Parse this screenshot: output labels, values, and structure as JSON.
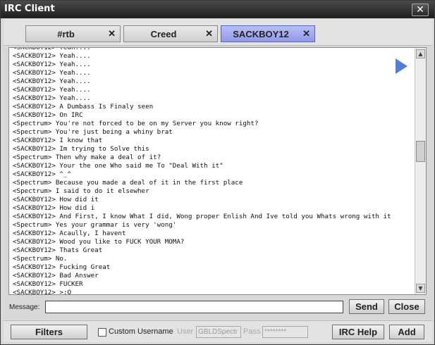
{
  "window": {
    "title": "IRC Client",
    "close_glyph": "✕"
  },
  "tabs": [
    {
      "label": "#rtb",
      "close": "✕",
      "active": false
    },
    {
      "label": "Creed",
      "close": "✕",
      "active": false
    },
    {
      "label": "SACKBOY12",
      "close": "✕",
      "active": true
    }
  ],
  "chat": {
    "lines": [
      "<SACKBOY12> Yeah....",
      "<SACKBOY12> Yeah....",
      "<SACKBOY12> Yeah....",
      "<SACKBOY12> Yeah....",
      "<SACKBOY12> Yeah....",
      "<SACKBOY12> Yeah....",
      "<SACKBOY12> Yeah....",
      "<SACKBOY12> A Dumbass Is Finaly seen",
      "<SACKBOY12> On IRC",
      "<Spectrum> You're not forced to be on my Server you know right?",
      "<Spectrum> You're just being a whiny brat",
      "<SACKBOY12> I know that",
      "<SACKBOY12> Im trying to Solve this",
      "<Spectrum> Then why make a deal of it?",
      "<SACKBOY12> Your the one Who said me To \"Deal With it\"",
      "<SACKBOY12> ^_^",
      "<Spectrum> Because you made a deal of it in the first place",
      "<Spectrum> I said to do it elsewher",
      "<SACKBOY12> How did it",
      "<SACKBOY12> How did i",
      "<SACKBOY12> And First, I know What I did, Wong proper Enlish And Ive told you Whats wrong with it",
      "<Spectrum> Yes your grammar is very 'wong'",
      "<SACKBOY12> Acaully, I havent",
      "<SACKBOY12> Wood you like to FUCK YOUR MOMA?",
      "<SACKBOY12> Thats Great",
      "<Spectrum> No.",
      "<SACKBOY12> Fucking Great",
      "<SACKBOY12> Bad Answer",
      "<SACKBOY12> FUCKER",
      "<SACKBOY12> >:O"
    ]
  },
  "message": {
    "label": "Message:",
    "value": ""
  },
  "buttons": {
    "send": "Send",
    "close": "Close",
    "filters": "Filters",
    "irc_help": "IRC Help",
    "add": "Add"
  },
  "options": {
    "custom_username_label": "Custom Username",
    "custom_username_checked": false,
    "user_label": "User",
    "user_value": "GBLDSpectr",
    "pass_label": "Pass",
    "pass_value": "********"
  },
  "scrollbar": {
    "up_glyph": "▲",
    "down_glyph": "▼"
  }
}
